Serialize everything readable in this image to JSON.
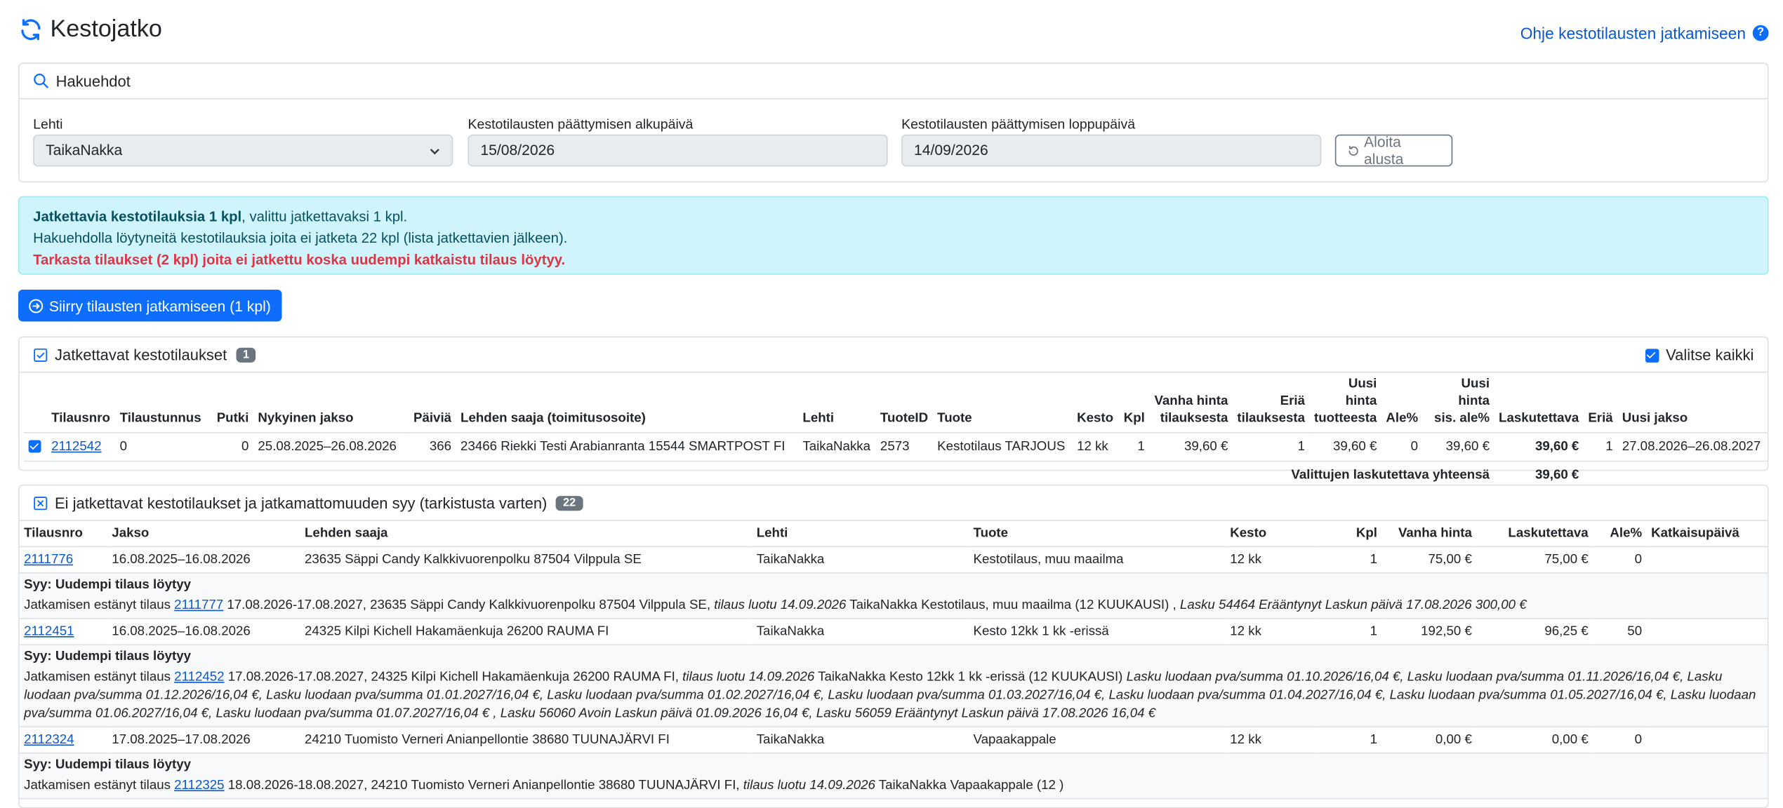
{
  "page": {
    "title": "Kestojatko",
    "help_link": "Ohje kestotilausten jatkamiseen",
    "help_icon": "?"
  },
  "search": {
    "header": "Hakuehdot",
    "lehti_label": "Lehti",
    "lehti_value": "TaikaNakka",
    "start_label": "Kestotilausten päättymisen alkupäivä",
    "start_value": "15/08/2026",
    "end_label": "Kestotilausten päättymisen loppupäivä",
    "end_value": "14/09/2026",
    "reset_button": "Aloita alusta"
  },
  "alert": {
    "line1_bold": "Jatkettavia kestotilauksia 1 kpl",
    "line1_rest": ", valittu jatkettavaksi 1 kpl.",
    "line2": "Hakuehdolla löytyneitä kestotilauksia joita ei jatketa 22 kpl (lista jatkettavien jälkeen).",
    "line3": "Tarkasta tilaukset (2 kpl) joita ei jatkettu koska uudempi katkaistu tilaus löytyy."
  },
  "primary_button": "Siirry tilausten jatkamiseen (1 kpl)",
  "continuing": {
    "header": "Jatkettavat kestotilaukset",
    "count": "1",
    "select_all": "Valitse kaikki",
    "columns": {
      "c1": "Tilausnro",
      "c2": "Tilaustunnus",
      "c3": "Putki",
      "c4": "Nykyinen jakso",
      "c5": "Päiviä",
      "c6": "Lehden saaja (toimitusosoite)",
      "c7": "Lehti",
      "c8": "TuoteID",
      "c9": "Tuote",
      "c10": "Kesto",
      "c11": "Kpl",
      "c12a": "Vanha hinta",
      "c12b": "tilauksesta",
      "c13a": "Eriä",
      "c13b": "tilauksesta",
      "c14a": "Uusi hinta",
      "c14b": "tuotteesta",
      "c15": "Ale%",
      "c16a": "Uusi hinta",
      "c16b": "sis. ale%",
      "c17": "Laskutettava",
      "c18": "Eriä",
      "c19": "Uusi jakso"
    },
    "rows": [
      {
        "tilausnro": "2112542",
        "tilaustunnus": "0",
        "putki": "0",
        "jakso": "25.08.2025–26.08.2026",
        "paivia": "366",
        "saaja": "23466 Riekki Testi Arabianranta 15544 SMARTPOST FI",
        "lehti": "TaikaNakka",
        "tuoteid": "2573",
        "tuote": "Kestotilaus TARJOUS",
        "kesto": "12 kk",
        "kpl": "1",
        "vanha_hinta": "39,60 €",
        "eria": "1",
        "uusi_hinta": "39,60 €",
        "ale": "0",
        "uusi_hinta_ale": "39,60 €",
        "laskutettava": "39,60 €",
        "eria2": "1",
        "uusi_jakso": "27.08.2026–26.08.2027"
      }
    ],
    "total_label": "Valittujen laskutettava yhteensä",
    "total_value": "39,60 €"
  },
  "not_continuing": {
    "header": "Ei jatkettavat kestotilaukset ja jatkamattomuuden syy (tarkistusta varten)",
    "count": "22",
    "columns": {
      "c1": "Tilausnro",
      "c2": "Jakso",
      "c3": "Lehden saaja",
      "c4": "Lehti",
      "c5": "Tuote",
      "c6": "Kesto",
      "c7": "Kpl",
      "c8": "Vanha hinta",
      "c9": "Laskutettava",
      "c10": "Ale%",
      "c11": "Katkaisupäivä"
    },
    "rows": [
      {
        "tilausnro": "2111776",
        "jakso": "16.08.2025–16.08.2026",
        "saaja": "23635 Säppi Candy Kalkkivuorenpolku 87504 Vilppula SE",
        "lehti": "TaikaNakka",
        "tuote": "Kestotilaus, muu maailma",
        "kesto": "12 kk",
        "kpl": "1",
        "vanha_hinta": "75,00 €",
        "laskutettava": "75,00 €",
        "ale": "0",
        "reason_title": "Syy: Uudempi tilaus löytyy",
        "reason_prefix": "Jatkamisen estänyt tilaus ",
        "reason_link": "2111777",
        "reason_mid": " 17.08.2026-17.08.2027, 23635 Säppi Candy Kalkkivuorenpolku 87504 Vilppula SE, ",
        "reason_i1": "tilaus luotu 14.09.2026",
        "reason_mid2": " TaikaNakka Kestotilaus, muu maailma (12 KUUKAUSI) , ",
        "reason_i2": "Lasku 54464 Erääntynyt Laskun päivä 17.08.2026 300,00 €"
      },
      {
        "tilausnro": "2112451",
        "jakso": "16.08.2025–16.08.2026",
        "saaja": "24325 Kilpi Kichell Hakamäenkuja 26200 RAUMA FI",
        "lehti": "TaikaNakka",
        "tuote": "Kesto 12kk 1 kk -erissä",
        "kesto": "12 kk",
        "kpl": "1",
        "vanha_hinta": "192,50 €",
        "laskutettava": "96,25 €",
        "ale": "50",
        "reason_title": "Syy: Uudempi tilaus löytyy",
        "reason_prefix": "Jatkamisen estänyt tilaus ",
        "reason_link": "2112452",
        "reason_mid": " 17.08.2026-17.08.2027, 24325 Kilpi Kichell Hakamäenkuja 26200 RAUMA FI, ",
        "reason_i1": "tilaus luotu 14.09.2026",
        "reason_mid2": " TaikaNakka Kesto 12kk 1 kk -erissä (12 KUUKAUSI) ",
        "reason_i2": "Lasku luodaan pva/summa 01.10.2026/16,04 €, Lasku luodaan pva/summa 01.11.2026/16,04 €, Lasku luodaan pva/summa 01.12.2026/16,04 €, Lasku luodaan pva/summa 01.01.2027/16,04 €, Lasku luodaan pva/summa 01.02.2027/16,04 €, Lasku luodaan pva/summa 01.03.2027/16,04 €, Lasku luodaan pva/summa 01.04.2027/16,04 €, Lasku luodaan pva/summa 01.05.2027/16,04 €, Lasku luodaan pva/summa 01.06.2027/16,04 €, Lasku luodaan pva/summa 01.07.2027/16,04 € , Lasku 56060 Avoin Laskun päivä 01.09.2026 16,04 €, Lasku 56059 Erääntynyt Laskun päivä 17.08.2026 16,04 €"
      },
      {
        "tilausnro": "2112324",
        "jakso": "17.08.2025–17.08.2026",
        "saaja": "24210 Tuomisto Verneri Anianpellontie 38680 TUUNAJÄRVI FI",
        "lehti": "TaikaNakka",
        "tuote": "Vapaakappale",
        "kesto": "12 kk",
        "kpl": "1",
        "vanha_hinta": "0,00 €",
        "laskutettava": "0,00 €",
        "ale": "0",
        "reason_title": "Syy: Uudempi tilaus löytyy",
        "reason_prefix": "Jatkamisen estänyt tilaus ",
        "reason_link": "2112325",
        "reason_mid": " 18.08.2026-18.08.2027, 24210 Tuomisto Verneri Anianpellontie 38680 TUUNAJÄRVI FI, ",
        "reason_i1": "tilaus luotu 14.09.2026",
        "reason_mid2": " TaikaNakka Vapaakappale (12 )",
        "reason_i2": ""
      }
    ]
  }
}
